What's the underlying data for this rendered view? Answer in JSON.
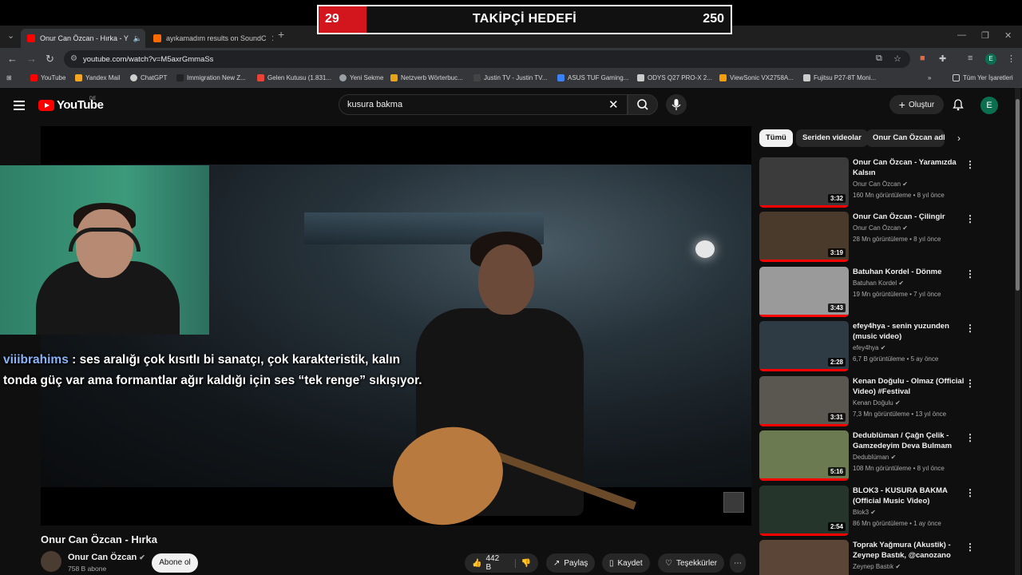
{
  "goal": {
    "current": "29",
    "title": "TAKİPÇİ HEDEFİ",
    "target": "250",
    "progress": 0.116
  },
  "browser": {
    "tabs": [
      {
        "label": "Onur Can Özcan - Hırka - Y",
        "active": true,
        "color": "#ff0000"
      },
      {
        "label": "ayıkamadım results on SoundC",
        "active": false,
        "color": "#ff6a00"
      }
    ],
    "url": "youtube.com/watch?v=M5axrGmmaSs",
    "bookmarks": [
      "YouTube",
      "Yandex Mail",
      "ChatGPT",
      "Immigration New Z...",
      "Gelen Kutusu (1.831...",
      "Yeni Sekme",
      "Netzverb Wörterbuc...",
      "Justin TV - Justin TV...",
      "ASUS TUF Gaming...",
      "ODYS Q27 PRO-X 2...",
      "ViewSonic VX2758A...",
      "Fujitsu P27-8T Moni..."
    ],
    "all_bookmarks": "Tüm Yer İşaretleri",
    "profile_letter": "E"
  },
  "youtube": {
    "region": "DE",
    "logo_text": "YouTube",
    "search_value": "kusura bakma",
    "create_label": "Oluştur",
    "avatar_letter": "E"
  },
  "chat": {
    "user": "viiibrahims",
    "message": " : ses aralığı çok kısıtlı bi sanatçı, çok karakteristik, kalın tonda güç var ama formantlar ağır kaldığı için ses “tek renge” sıkışıyor."
  },
  "video": {
    "title": "Onur Can Özcan - Hırka",
    "channel": "Onur Can Özcan",
    "subscribers": "758 B abone",
    "subscribe_label": "Abone ol",
    "likes": "442 B",
    "share_label": "Paylaş",
    "save_label": "Kaydet",
    "thanks_label": "Teşekkürler"
  },
  "chips": [
    "Tümü",
    "Seriden videolar",
    "Onur Can Özcan adlı y"
  ],
  "recommendations": [
    {
      "title": "Onur Can Özcan - Yaramızda Kalsın",
      "channel": "Onur Can Özcan",
      "meta": "160 Mn görüntüleme • 8 yıl önce",
      "duration": "3:32",
      "thumb_color": "#3b3b3b"
    },
    {
      "title": "Onur Can Özcan - Çilingir",
      "channel": "Onur Can Özcan",
      "meta": "28 Mn görüntüleme • 8 yıl önce",
      "duration": "3:19",
      "thumb_color": "#4a3a2c"
    },
    {
      "title": "Batuhan Kordel - Dönme",
      "channel": "Batuhan Kordel",
      "meta": "19 Mn görüntüleme • 7 yıl önce",
      "duration": "3:43",
      "thumb_color": "#9a9a9a"
    },
    {
      "title": "efey4hya - senin yuzunden (music video)",
      "channel": "efey4hya",
      "meta": "6,7 B görüntüleme • 5 ay önce",
      "duration": "2:28",
      "thumb_color": "#2f3b44"
    },
    {
      "title": "Kenan Doğulu - Olmaz (Official Video) #Festival",
      "channel": "Kenan Doğulu",
      "meta": "7,3 Mn görüntüleme • 13 yıl önce",
      "duration": "3:31",
      "thumb_color": "#5a5650"
    },
    {
      "title": "Dedublüman / Çağn Çelik - Gamzedeyim Deva Bulmam",
      "channel": "Dedublüman",
      "meta": "108 Mn görüntüleme • 8 yıl önce",
      "duration": "5:16",
      "thumb_color": "#6c7a52"
    },
    {
      "title": "BLOK3 - KUSURA BAKMA (Official Music Video)",
      "channel": "Blok3",
      "meta": "86 Mn görüntüleme • 1 ay önce",
      "duration": "2:54",
      "thumb_color": "#26352c"
    },
    {
      "title": "Toprak Yağmura (Akustik) - Zeynep Bastık, @canozano",
      "channel": "Zeynep Bastık",
      "meta": "",
      "duration": "",
      "thumb_color": "#5b4536"
    }
  ]
}
